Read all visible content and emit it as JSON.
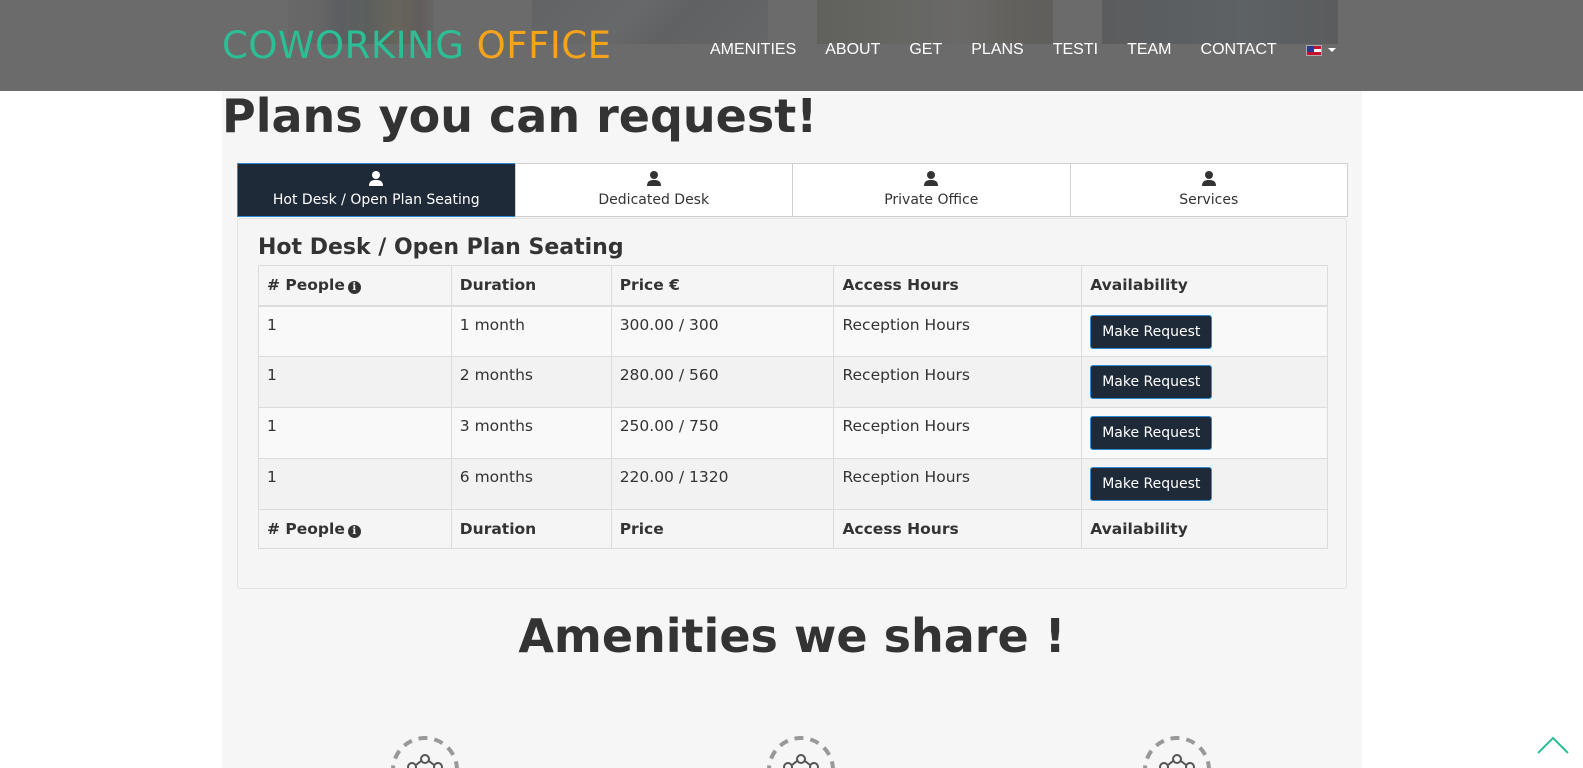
{
  "brand": {
    "part1": "COWORKING",
    "part2": "OFFICE",
    "color1": "#2bbf95",
    "color2": "#f4a31a"
  },
  "nav": {
    "items": [
      {
        "label": "AMENITIES"
      },
      {
        "label": "ABOUT"
      },
      {
        "label": "GET"
      },
      {
        "label": "PLANS"
      },
      {
        "label": "TESTI"
      },
      {
        "label": "TEAM"
      },
      {
        "label": "CONTACT"
      }
    ],
    "language_icon": "uk-flag-icon"
  },
  "plans_section": {
    "title": "Plans you can request!",
    "tabs": [
      {
        "label": "Hot Desk / Open Plan Seating",
        "icon": "user-icon",
        "active": true
      },
      {
        "label": "Dedicated Desk",
        "icon": "user-icon",
        "active": false
      },
      {
        "label": "Private Office",
        "icon": "user-icon",
        "active": false
      },
      {
        "label": "Services",
        "icon": "user-icon",
        "active": false
      }
    ],
    "panel": {
      "title": "Hot Desk / Open Plan Seating",
      "header": [
        "# People",
        "Duration",
        "Price €",
        "Access Hours",
        "Availability"
      ],
      "footer": [
        "# People",
        "Duration",
        "Price",
        "Access Hours",
        "Availability"
      ],
      "rows": [
        {
          "people": "1",
          "duration": "1 month",
          "price": "300.00 / 300",
          "access": "Reception Hours",
          "action": "Make Request"
        },
        {
          "people": "1",
          "duration": "2 months",
          "price": "280.00 / 560",
          "access": "Reception Hours",
          "action": "Make Request"
        },
        {
          "people": "1",
          "duration": "3 months",
          "price": "250.00 / 750",
          "access": "Reception Hours",
          "action": "Make Request"
        },
        {
          "people": "1",
          "duration": "6 months",
          "price": "220.00 / 1320",
          "access": "Reception Hours",
          "action": "Make Request"
        }
      ]
    }
  },
  "amenities_section": {
    "title": "Amenities we share !",
    "icons": [
      "network-icon",
      "network-icon",
      "network-icon"
    ]
  },
  "colors": {
    "dark": "#1f2a38",
    "accent_border": "#2b8bd6",
    "teal": "#2bbf95"
  }
}
